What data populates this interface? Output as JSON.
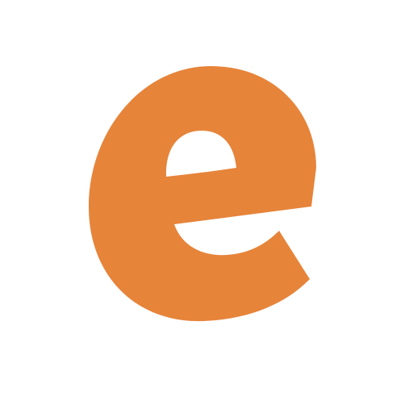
{
  "logo": {
    "text": "e",
    "icon": "letter-e-logo",
    "color": "#E6843A",
    "background": "#FFFFFF"
  }
}
